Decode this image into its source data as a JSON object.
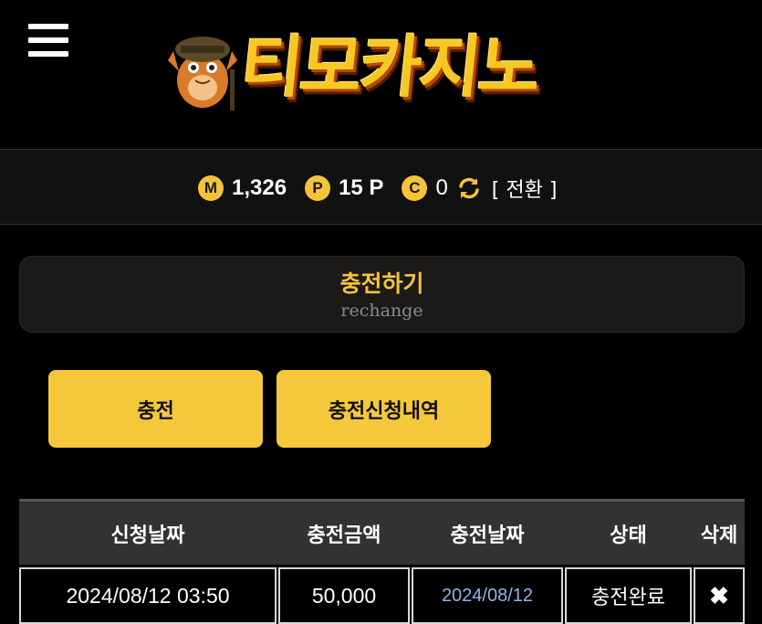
{
  "header": {
    "logo_text": "티모카지노"
  },
  "balance": {
    "money_icon": "M",
    "money_value": "1,326",
    "point_icon": "P",
    "point_value": "15 P",
    "coin_icon": "C",
    "coin_value": "0",
    "convert_label": "[ 전환 ]"
  },
  "page": {
    "title": "충전하기",
    "subtitle": "rechange"
  },
  "buttons": {
    "charge_label": "충전",
    "history_label": "충전신청내역"
  },
  "table": {
    "headers": [
      "신청날짜",
      "충전금액",
      "충전날짜",
      "상태",
      "삭제"
    ],
    "rows": [
      {
        "request_date": "2024/08/12 03:50",
        "amount": "50,000",
        "charge_date": "2024/08/12",
        "status": "충전완료",
        "delete_icon": "✖"
      }
    ]
  },
  "colors": {
    "accent": "#f4c83a",
    "link_blue": "#8fb4ea"
  }
}
